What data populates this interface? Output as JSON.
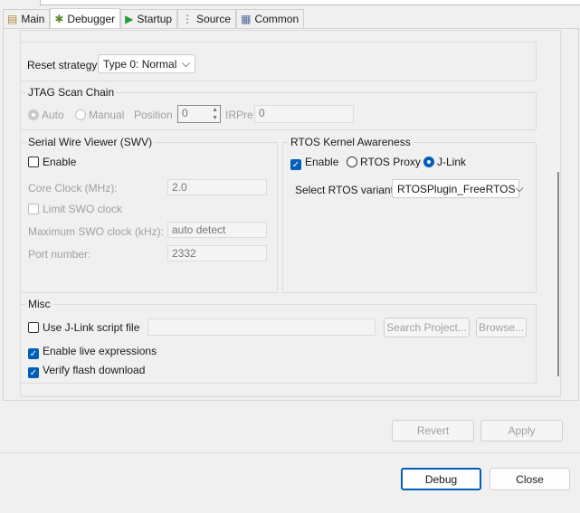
{
  "tabs": [
    {
      "label": "Main",
      "icon": "document-icon"
    },
    {
      "label": "Debugger",
      "icon": "bug-icon"
    },
    {
      "label": "Startup",
      "icon": "play-icon"
    },
    {
      "label": "Source",
      "icon": "source-tree-icon"
    },
    {
      "label": "Common",
      "icon": "table-icon"
    }
  ],
  "reset": {
    "label": "Reset strategy",
    "value": "Type 0: Normal"
  },
  "jtag": {
    "title": "JTAG Scan Chain",
    "auto": "Auto",
    "manual": "Manual",
    "position_label": "Position",
    "position_value": "0",
    "irpre_label": "IRPre",
    "irpre_value": "0"
  },
  "swv": {
    "title": "Serial Wire Viewer (SWV)",
    "enable": "Enable",
    "core_clock_label": "Core Clock (MHz):",
    "core_clock_value": "2.0",
    "limit_swo": "Limit SWO clock",
    "max_swo_label": "Maximum SWO clock (kHz):",
    "max_swo_value": "auto detect",
    "port_label": "Port number:",
    "port_value": "2332"
  },
  "rtos": {
    "title": "RTOS Kernel Awareness",
    "enable": "Enable",
    "proxy": "RTOS Proxy",
    "jlink": "J-Link",
    "variant_label": "Select RTOS variant:",
    "variant_value": "RTOSPlugin_FreeRTOS"
  },
  "misc": {
    "title": "Misc",
    "script": "Use J-Link script file",
    "search": "Search Project...",
    "browse": "Browse...",
    "live": "Enable live expressions",
    "verify": "Verify flash download"
  },
  "buttons": {
    "revert": "Revert",
    "apply": "Apply",
    "debug": "Debug",
    "close": "Close"
  },
  "colors": {
    "accent": "#005fb8"
  }
}
